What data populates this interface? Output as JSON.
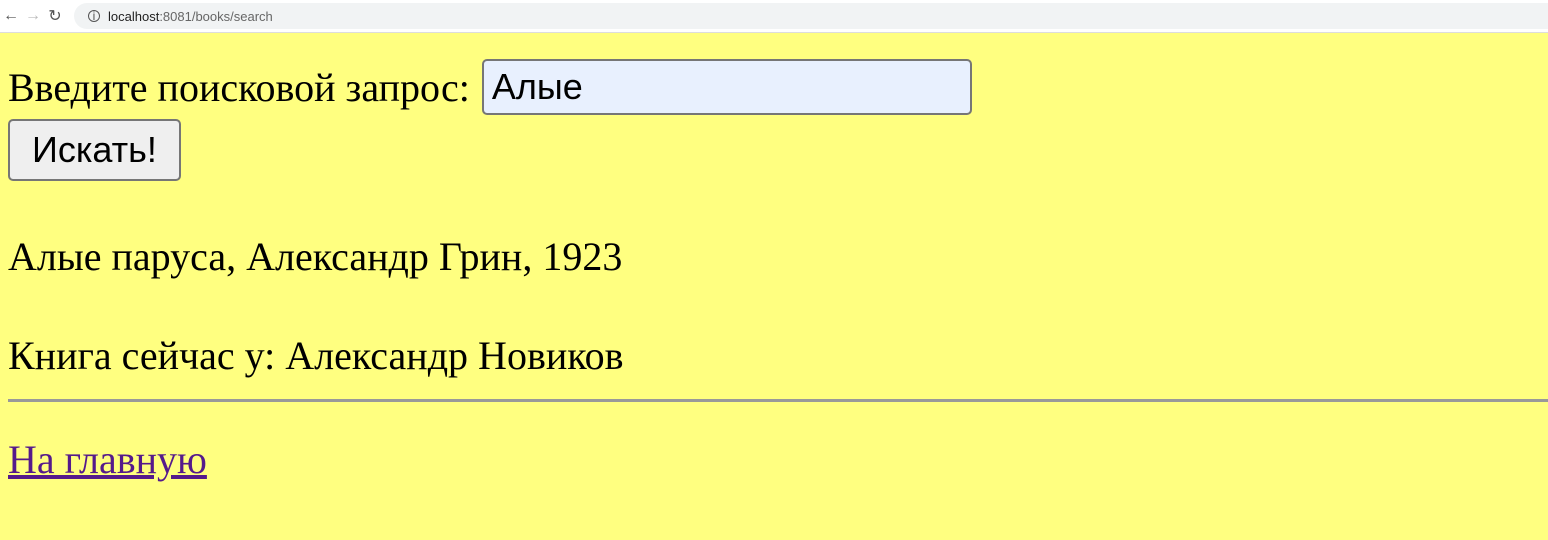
{
  "browser": {
    "url_host": "localhost",
    "url_rest": ":8081/books/search"
  },
  "form": {
    "label": "Введите поисковой запрос:",
    "query": "Алые",
    "submit": "Искать!"
  },
  "results": {
    "book": "Алые паруса, Александр Грин, 1923",
    "holder": "Книга сейчас у: Александр Новиков"
  },
  "link": "На главную"
}
